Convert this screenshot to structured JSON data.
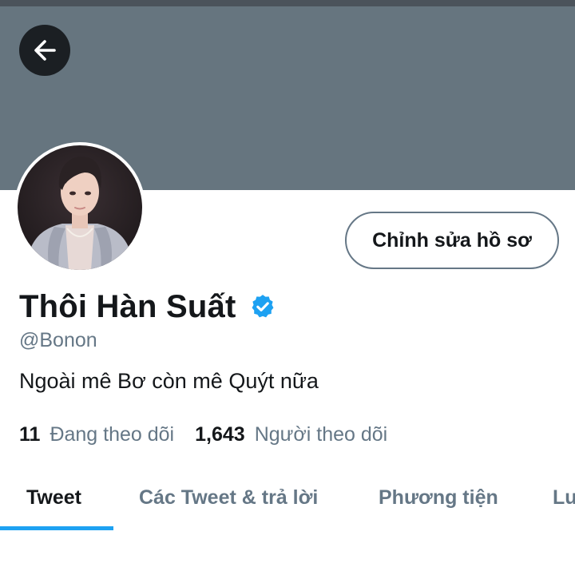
{
  "header": {
    "back_icon": "arrow-left-icon"
  },
  "profile": {
    "display_name": "Thôi Hàn Suất",
    "verified_icon": "verified-badge-icon",
    "handle": "@Bonon",
    "bio": "Ngoài mê Bơ còn mê Quýt nữa",
    "edit_button_label": "Chỉnh sửa hồ sơ",
    "avatar_icon": "profile-photo"
  },
  "stats": {
    "following_count": "11",
    "following_label": "Đang theo dõi",
    "followers_count": "1,643",
    "followers_label": "Người theo dõi"
  },
  "tabs": [
    {
      "label": "Tweet",
      "active": true
    },
    {
      "label": "Các Tweet & trả lời",
      "active": false
    },
    {
      "label": "Phương tiện",
      "active": false
    },
    {
      "label": "Lu",
      "active": false
    }
  ],
  "colors": {
    "banner": "#66757f",
    "accent": "#1da1f2",
    "secondary_text": "#657786",
    "primary_text": "#14171a"
  }
}
